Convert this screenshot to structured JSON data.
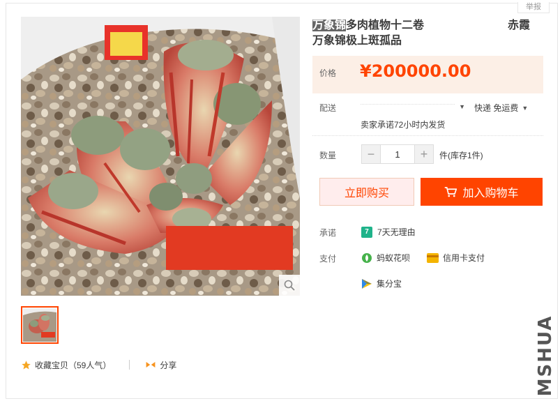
{
  "header": {
    "report_label": "举报"
  },
  "product": {
    "title_highlight": "万象锦",
    "title_rest": "多肉植物十二卷",
    "title_tail": "赤霞",
    "title_line2": "万象锦极上斑孤品",
    "image_name": "万象锦 succulent in pot with pebbles"
  },
  "price": {
    "label": "价格",
    "value": "¥200000.00"
  },
  "shipping": {
    "label": "配送",
    "express": "快递 免运费",
    "promise": "卖家承诺72小时内发货"
  },
  "quantity": {
    "label": "数量",
    "value": "1",
    "minus": "−",
    "plus": "+",
    "stock": "件(库存1件)"
  },
  "buttons": {
    "buy_now": "立即购买",
    "add_cart": "加入购物车"
  },
  "service": {
    "label": "承诺",
    "item": "7天无理由",
    "badge": "7"
  },
  "payment": {
    "label": "支付",
    "methods": [
      "蚂蚁花呗",
      "信用卡支付",
      "集分宝"
    ]
  },
  "actions": {
    "favorite": "收藏宝贝（59人气）",
    "share": "分享"
  },
  "watermark": "MSHUA",
  "colors": {
    "accent": "#ff4400",
    "price_bg": "#fcefe6",
    "buy_now_bg": "#ffeded"
  },
  "icons": [
    "search-icon",
    "cart-icon",
    "star-icon",
    "share-icon",
    "seven-day-icon",
    "huabei-icon",
    "credit-card-icon",
    "jifenbao-icon"
  ]
}
